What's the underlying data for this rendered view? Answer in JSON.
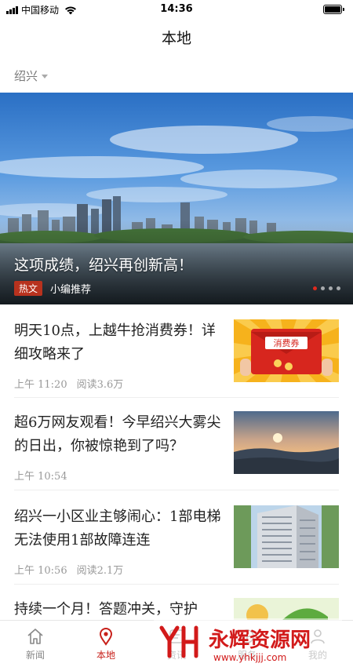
{
  "status_bar": {
    "carrier": "中国移动",
    "time": "14:36"
  },
  "header": {
    "title": "本地"
  },
  "city_selector": {
    "city": "绍兴"
  },
  "banner": {
    "title": "这项成绩，绍兴再创新高！",
    "badge": "热文",
    "tag": "小编推荐",
    "slide_count": 4,
    "active_slide": 1
  },
  "news": [
    {
      "title": "明天10点，上越牛抢消费券！详细攻略来了",
      "time": "上午 11:20",
      "reads": "阅读3.6万",
      "thumb_label": "消费券"
    },
    {
      "title": "超6万网友观看！今早绍兴大雾尖的日出，你被惊艳到了吗？",
      "time": "上午 10:54",
      "reads": ""
    },
    {
      "title": "绍兴一小区业主够闹心：1部电梯无法使用1部故障连连",
      "time": "上午 10:56",
      "reads": "阅读2.1万"
    },
    {
      "title": "持续一个月！答题冲关，守护",
      "time": "",
      "reads": ""
    }
  ],
  "tab_bar": {
    "tabs": [
      {
        "label": "新闻",
        "icon": "home-icon",
        "active": false
      },
      {
        "label": "本地",
        "icon": "location-pin-icon",
        "active": true
      },
      {
        "label": "资讯",
        "icon": "info-icon",
        "active": false
      },
      {
        "label": "服务",
        "icon": "service-icon",
        "active": false
      },
      {
        "label": "我的",
        "icon": "user-icon",
        "active": false
      }
    ]
  },
  "watermark": {
    "brand": "永辉资源网",
    "url": "www.yhkjjj.com"
  },
  "colors": {
    "accent": "#c8201a",
    "badge": "#b8321e",
    "meta_text": "#999999"
  }
}
